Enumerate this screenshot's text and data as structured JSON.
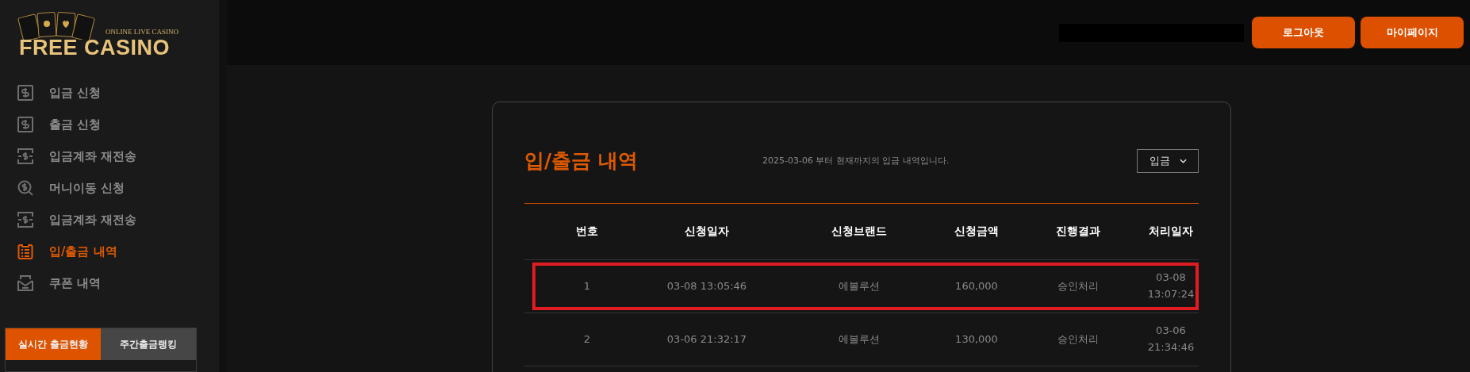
{
  "logo": {
    "tagline": "ONLINE LIVE CASINO",
    "name": "FREE CASINO"
  },
  "sidebar": {
    "items": [
      {
        "label": "입금 신청",
        "selected": false
      },
      {
        "label": "출금 신청",
        "selected": false
      },
      {
        "label": "입금계좌 재전송",
        "selected": false
      },
      {
        "label": "머니이동 신청",
        "selected": false
      },
      {
        "label": "입금계좌 재전송",
        "selected": false
      },
      {
        "label": "입/출금 내역",
        "selected": true
      },
      {
        "label": "쿠폰 내역",
        "selected": false
      }
    ],
    "tabs": [
      {
        "label": "실시간 출금현황",
        "selected": true
      },
      {
        "label": "주간출금랭킹",
        "selected": false
      }
    ]
  },
  "header": {
    "buttons": [
      "로그아웃",
      "마이페이지"
    ]
  },
  "card": {
    "title": "입/출금 내역",
    "subtitle": "2025-03-06 부터 현재까지의 입금 내역입니다.",
    "filter": {
      "value": "입금"
    },
    "table": {
      "columns": [
        "번호",
        "신청일자",
        "신청브랜드",
        "신청금액",
        "진행결과",
        "처리일자"
      ],
      "rows": [
        {
          "highlighted": true,
          "cells": [
            "1",
            "03-08 13:05:46",
            "에볼루션",
            "160,000",
            "승인처리",
            "03-08\n13:07:24"
          ]
        },
        {
          "highlighted": false,
          "cells": [
            "2",
            "03-06 21:32:17",
            "에볼루션",
            "130,000",
            "승인처리",
            "03-06\n21:34:46"
          ]
        }
      ]
    }
  }
}
